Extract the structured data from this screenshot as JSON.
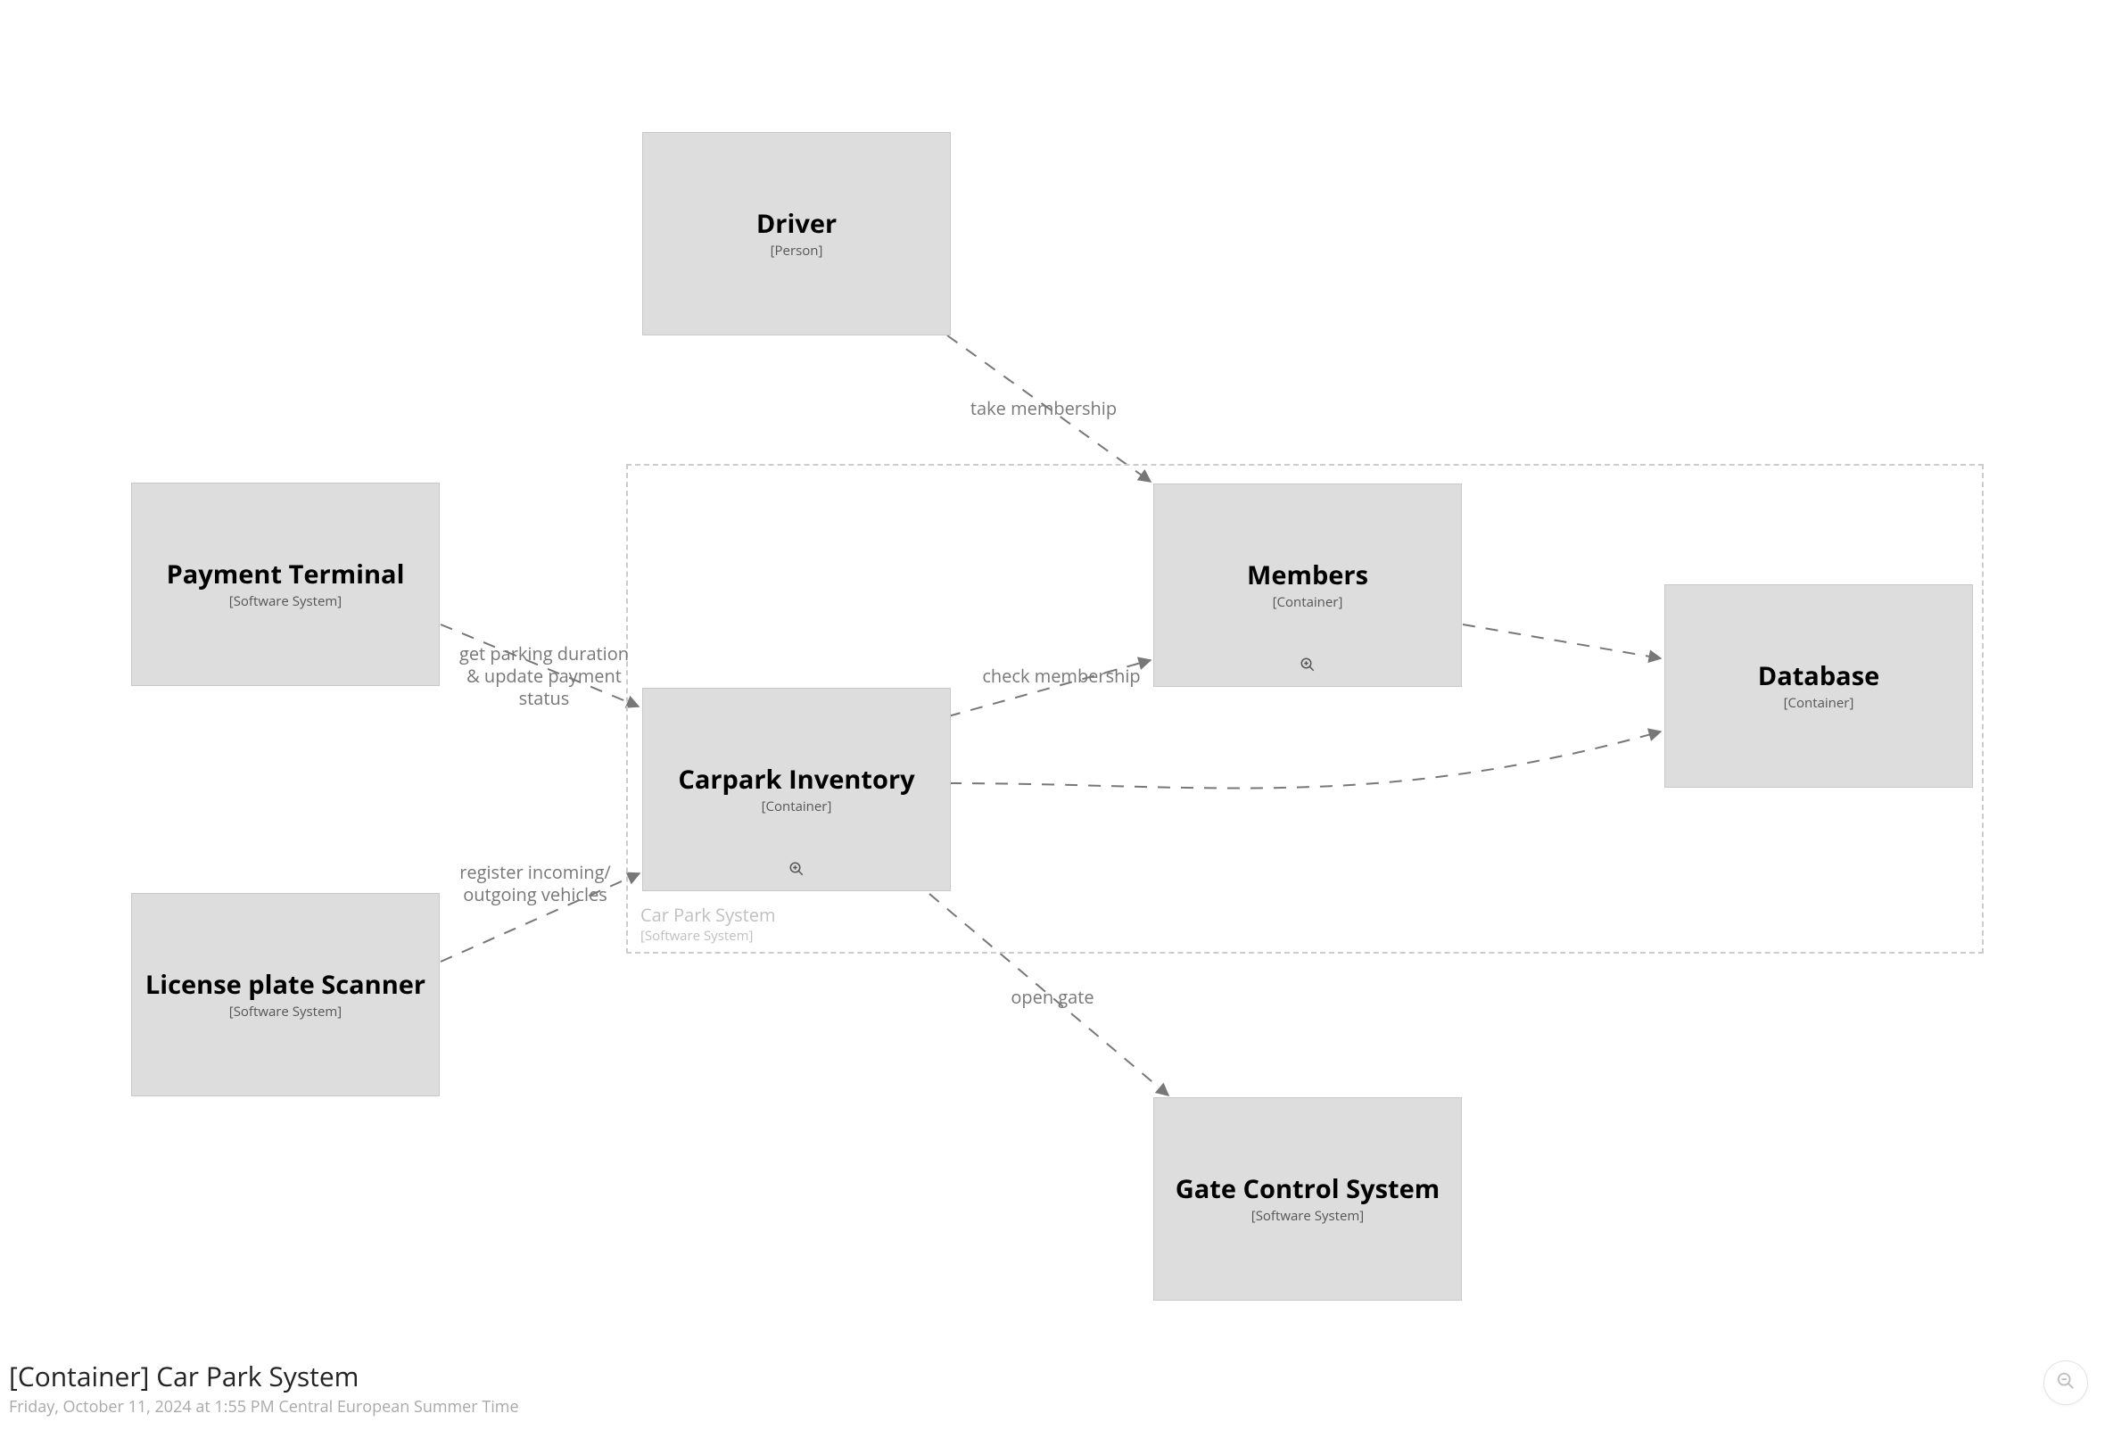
{
  "diagram": {
    "title": "[Container] Car Park System",
    "timestamp": "Friday, October 11, 2024 at 1:55 PM Central European Summer Time"
  },
  "boundary": {
    "name": "Car Park System",
    "stereo": "[Software System]"
  },
  "nodes": {
    "driver": {
      "title": "Driver",
      "stereo": "[Person]"
    },
    "payment": {
      "title": "Payment Terminal",
      "stereo": "[Software System]"
    },
    "scanner": {
      "title": "License plate Scanner",
      "stereo": "[Software System]"
    },
    "members": {
      "title": "Members",
      "stereo": "[Container]"
    },
    "inventory": {
      "title": "Carpark Inventory",
      "stereo": "[Container]"
    },
    "database": {
      "title": "Database",
      "stereo": "[Container]"
    },
    "gate": {
      "title": "Gate Control System",
      "stereo": "[Software System]"
    }
  },
  "edges": {
    "driver_members": "take membership",
    "payment_inventory": "get parking duration & update payment status",
    "scanner_inventory": "register incoming/ outgoing vehicles",
    "inventory_members": "check membership",
    "inventory_gate": "open gate"
  },
  "chart_data": {
    "type": "diagram-c4-container",
    "boundary": {
      "id": "carparksystem",
      "name": "Car Park System",
      "stereo": "Software System"
    },
    "elements": [
      {
        "id": "driver",
        "name": "Driver",
        "stereo": "Person",
        "inside_boundary": false
      },
      {
        "id": "payment",
        "name": "Payment Terminal",
        "stereo": "Software System",
        "inside_boundary": false
      },
      {
        "id": "scanner",
        "name": "License plate Scanner",
        "stereo": "Software System",
        "inside_boundary": false
      },
      {
        "id": "members",
        "name": "Members",
        "stereo": "Container",
        "inside_boundary": true
      },
      {
        "id": "inventory",
        "name": "Carpark Inventory",
        "stereo": "Container",
        "inside_boundary": true
      },
      {
        "id": "database",
        "name": "Database",
        "stereo": "Container",
        "inside_boundary": true
      },
      {
        "id": "gate",
        "name": "Gate Control System",
        "stereo": "Software System",
        "inside_boundary": false
      }
    ],
    "relationships": [
      {
        "from": "driver",
        "to": "members",
        "label": "take membership"
      },
      {
        "from": "payment",
        "to": "inventory",
        "label": "get parking duration & update payment status"
      },
      {
        "from": "scanner",
        "to": "inventory",
        "label": "register incoming/ outgoing vehicles"
      },
      {
        "from": "inventory",
        "to": "members",
        "label": "check membership"
      },
      {
        "from": "inventory",
        "to": "database",
        "label": ""
      },
      {
        "from": "members",
        "to": "database",
        "label": ""
      },
      {
        "from": "inventory",
        "to": "gate",
        "label": "open gate"
      }
    ]
  }
}
